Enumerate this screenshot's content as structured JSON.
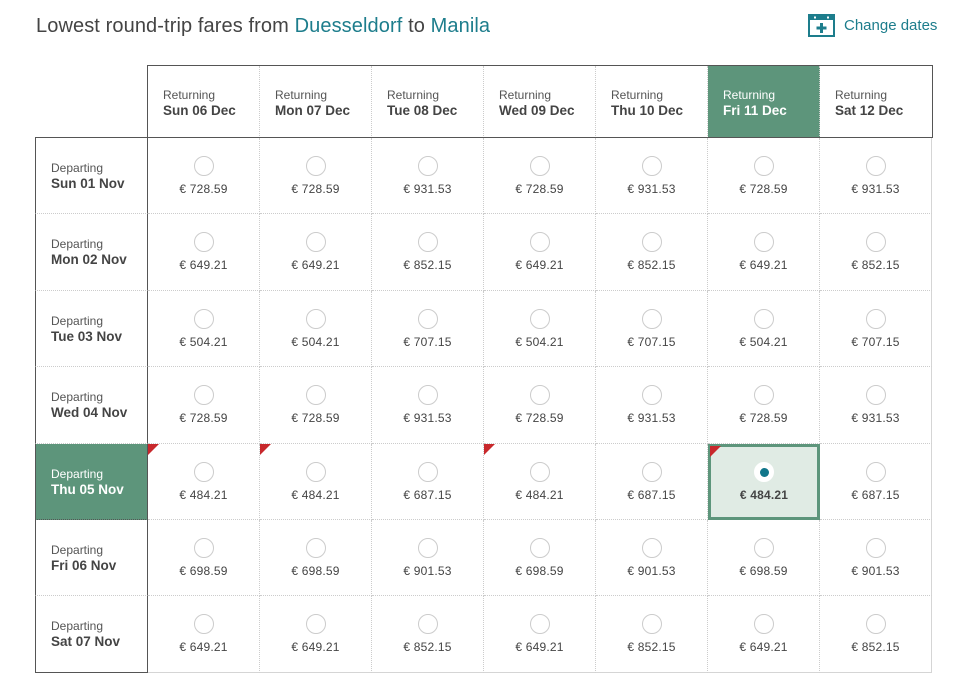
{
  "header": {
    "title_prefix": "Lowest round-trip fares from",
    "origin": "Duesseldorf",
    "title_mid": "to",
    "destination": "Manila",
    "change_dates_label": "Change dates",
    "change_dates_icon": "calendar-plus-icon"
  },
  "colors": {
    "accent": "#1d7d8c",
    "active_green": "#5d957b",
    "selected_bg": "#e0ebe4",
    "flag_red": "#c8282c",
    "radio_dot": "#11768a"
  },
  "returning_label": "Returning",
  "departing_label": "Departing",
  "return_dates": [
    "Sun 06 Dec",
    "Mon 07 Dec",
    "Tue 08 Dec",
    "Wed 09 Dec",
    "Thu 10 Dec",
    "Fri 11 Dec",
    "Sat 12 Dec"
  ],
  "selected_return_index": 5,
  "rows": [
    {
      "departing": "Sun 01 Nov",
      "prices": [
        "€ 728.59",
        "€ 728.59",
        "€ 931.53",
        "€ 728.59",
        "€ 931.53",
        "€ 728.59",
        "€ 931.53"
      ],
      "cheapest_flags": [
        false,
        false,
        false,
        false,
        false,
        false,
        false
      ]
    },
    {
      "departing": "Mon 02 Nov",
      "prices": [
        "€ 649.21",
        "€ 649.21",
        "€ 852.15",
        "€ 649.21",
        "€ 852.15",
        "€ 649.21",
        "€ 852.15"
      ],
      "cheapest_flags": [
        false,
        false,
        false,
        false,
        false,
        false,
        false
      ]
    },
    {
      "departing": "Tue 03 Nov",
      "prices": [
        "€ 504.21",
        "€ 504.21",
        "€ 707.15",
        "€ 504.21",
        "€ 707.15",
        "€ 504.21",
        "€ 707.15"
      ],
      "cheapest_flags": [
        false,
        false,
        false,
        false,
        false,
        false,
        false
      ]
    },
    {
      "departing": "Wed 04 Nov",
      "prices": [
        "€ 728.59",
        "€ 728.59",
        "€ 931.53",
        "€ 728.59",
        "€ 931.53",
        "€ 728.59",
        "€ 931.53"
      ],
      "cheapest_flags": [
        false,
        false,
        false,
        false,
        false,
        false,
        false
      ]
    },
    {
      "departing": "Thu 05 Nov",
      "prices": [
        "€ 484.21",
        "€ 484.21",
        "€ 687.15",
        "€ 484.21",
        "€ 687.15",
        "€ 484.21",
        "€ 687.15"
      ],
      "cheapest_flags": [
        true,
        true,
        false,
        true,
        false,
        true,
        false
      ]
    },
    {
      "departing": "Fri 06 Nov",
      "prices": [
        "€ 698.59",
        "€ 698.59",
        "€ 901.53",
        "€ 698.59",
        "€ 901.53",
        "€ 698.59",
        "€ 901.53"
      ],
      "cheapest_flags": [
        false,
        false,
        false,
        false,
        false,
        false,
        false
      ]
    },
    {
      "departing": "Sat 07 Nov",
      "prices": [
        "€ 649.21",
        "€ 649.21",
        "€ 852.15",
        "€ 649.21",
        "€ 852.15",
        "€ 649.21",
        "€ 852.15"
      ],
      "cheapest_flags": [
        false,
        false,
        false,
        false,
        false,
        false,
        false
      ]
    }
  ],
  "selected_departure_index": 4
}
